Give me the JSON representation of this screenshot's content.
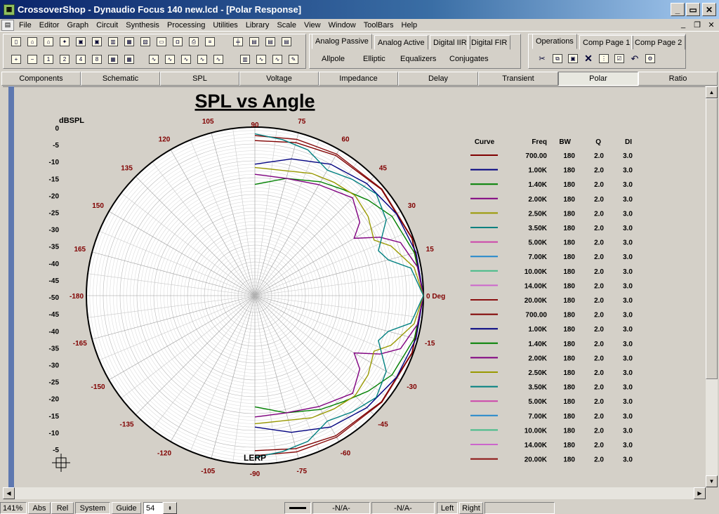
{
  "window": {
    "title": "CrossoverShop - Dynaudio Focus 140 new.lcd - [Polar Response]",
    "minimize": "_",
    "maximize": "▭",
    "close": "✕"
  },
  "menu": [
    "File",
    "Editor",
    "Graph",
    "Circuit",
    "Synthesis",
    "Processing",
    "Utilities",
    "Library",
    "Scale",
    "View",
    "Window",
    "ToolBars",
    "Help"
  ],
  "tabs_synthesis": [
    "Analog Passive",
    "Analog Active",
    "Digital IIR",
    "Digital FIR"
  ],
  "synthesis_subitems": [
    "Allpole",
    "Elliptic",
    "Equalizers",
    "Conjugates"
  ],
  "tabs_operations": [
    "Operations",
    "Comp Page 1",
    "Comp Page 2"
  ],
  "modes": [
    "Components",
    "Schematic",
    "SPL",
    "Voltage",
    "Impedance",
    "Delay",
    "Transient",
    "Polar",
    "Ratio"
  ],
  "active_mode": "Polar",
  "chart_data": {
    "type": "polar",
    "title": "SPL vs Angle",
    "radial_axis_label": "dBSPL",
    "radial_ticks": [
      "0",
      "-5",
      "-10",
      "-15",
      "-20",
      "-25",
      "-30",
      "-35",
      "-40",
      "-45",
      "-50",
      "-45",
      "-40",
      "-35",
      "-30",
      "-25",
      "-20",
      "-15",
      "-10",
      "-5"
    ],
    "angle_labels": [
      {
        "deg": 0,
        "text": "0 Deg"
      },
      {
        "deg": 15,
        "text": "15"
      },
      {
        "deg": 30,
        "text": "30"
      },
      {
        "deg": 45,
        "text": "45"
      },
      {
        "deg": 60,
        "text": "60"
      },
      {
        "deg": 75,
        "text": "75"
      },
      {
        "deg": 90,
        "text": "90"
      },
      {
        "deg": 105,
        "text": "105"
      },
      {
        "deg": 120,
        "text": "120"
      },
      {
        "deg": 135,
        "text": "135"
      },
      {
        "deg": 150,
        "text": "150"
      },
      {
        "deg": 165,
        "text": "165"
      },
      {
        "deg": 180,
        "text": "-180"
      },
      {
        "deg": -165,
        "text": "-165"
      },
      {
        "deg": -150,
        "text": "-150"
      },
      {
        "deg": -135,
        "text": "-135"
      },
      {
        "deg": -120,
        "text": "-120"
      },
      {
        "deg": -105,
        "text": "-105"
      },
      {
        "deg": -90,
        "text": "-90"
      },
      {
        "deg": -75,
        "text": "-75"
      },
      {
        "deg": -60,
        "text": "-60"
      },
      {
        "deg": -45,
        "text": "-45"
      },
      {
        "deg": -30,
        "text": "-30"
      },
      {
        "deg": -15,
        "text": "-15"
      }
    ],
    "annotation": "LERP",
    "table_headers": [
      "Curve",
      "Freq",
      "BW",
      "Q",
      "DI"
    ],
    "series": [
      {
        "freq": "700.00",
        "bw": "180",
        "q": "2.0",
        "di": "3.0",
        "color": "#800000",
        "side": "pos"
      },
      {
        "freq": "1.00K",
        "bw": "180",
        "q": "2.0",
        "di": "3.0",
        "color": "#000080",
        "side": "pos"
      },
      {
        "freq": "1.40K",
        "bw": "180",
        "q": "2.0",
        "di": "3.0",
        "color": "#008000",
        "side": "pos"
      },
      {
        "freq": "2.00K",
        "bw": "180",
        "q": "2.0",
        "di": "3.0",
        "color": "#800080",
        "side": "pos"
      },
      {
        "freq": "2.50K",
        "bw": "180",
        "q": "2.0",
        "di": "3.0",
        "color": "#999900",
        "side": "pos"
      },
      {
        "freq": "3.50K",
        "bw": "180",
        "q": "2.0",
        "di": "3.0",
        "color": "#008080",
        "side": "pos"
      },
      {
        "freq": "5.00K",
        "bw": "180",
        "q": "2.0",
        "di": "3.0",
        "color": "#cc44aa",
        "side": "pos"
      },
      {
        "freq": "7.00K",
        "bw": "180",
        "q": "2.0",
        "di": "3.0",
        "color": "#2288cc",
        "side": "pos"
      },
      {
        "freq": "10.00K",
        "bw": "180",
        "q": "2.0",
        "di": "3.0",
        "color": "#44bb88",
        "side": "pos"
      },
      {
        "freq": "14.00K",
        "bw": "180",
        "q": "2.0",
        "di": "3.0",
        "color": "#cc66cc",
        "side": "pos"
      },
      {
        "freq": "20.00K",
        "bw": "180",
        "q": "2.0",
        "di": "3.0",
        "color": "#8b1010",
        "side": "pos"
      },
      {
        "freq": "700.00",
        "bw": "180",
        "q": "2.0",
        "di": "3.0",
        "color": "#800000",
        "side": "neg"
      },
      {
        "freq": "1.00K",
        "bw": "180",
        "q": "2.0",
        "di": "3.0",
        "color": "#000080",
        "side": "neg"
      },
      {
        "freq": "1.40K",
        "bw": "180",
        "q": "2.0",
        "di": "3.0",
        "color": "#008000",
        "side": "neg"
      },
      {
        "freq": "2.00K",
        "bw": "180",
        "q": "2.0",
        "di": "3.0",
        "color": "#800080",
        "side": "neg"
      },
      {
        "freq": "2.50K",
        "bw": "180",
        "q": "2.0",
        "di": "3.0",
        "color": "#999900",
        "side": "neg"
      },
      {
        "freq": "3.50K",
        "bw": "180",
        "q": "2.0",
        "di": "3.0",
        "color": "#008080",
        "side": "neg"
      },
      {
        "freq": "5.00K",
        "bw": "180",
        "q": "2.0",
        "di": "3.0",
        "color": "#cc44aa",
        "side": "neg"
      },
      {
        "freq": "7.00K",
        "bw": "180",
        "q": "2.0",
        "di": "3.0",
        "color": "#2288cc",
        "side": "neg"
      },
      {
        "freq": "10.00K",
        "bw": "180",
        "q": "2.0",
        "di": "3.0",
        "color": "#44bb88",
        "side": "neg"
      },
      {
        "freq": "14.00K",
        "bw": "180",
        "q": "2.0",
        "di": "3.0",
        "color": "#cc66cc",
        "side": "neg"
      },
      {
        "freq": "20.00K",
        "bw": "180",
        "q": "2.0",
        "di": "3.0",
        "color": "#8b1010",
        "side": "neg"
      }
    ],
    "curves": [
      {
        "color": "#8b1010",
        "points": [
          [
            0,
            0
          ],
          [
            20,
            -0.3
          ],
          [
            40,
            -0.8
          ],
          [
            60,
            -1.5
          ],
          [
            75,
            -2
          ],
          [
            90,
            -2.5
          ]
        ]
      },
      {
        "color": "#800000",
        "points": [
          [
            0,
            0
          ],
          [
            20,
            -0.4
          ],
          [
            40,
            -1
          ],
          [
            60,
            -2
          ],
          [
            75,
            -3
          ],
          [
            90,
            -4
          ]
        ]
      },
      {
        "color": "#000080",
        "points": [
          [
            0,
            0
          ],
          [
            15,
            -0.5
          ],
          [
            30,
            -1.5
          ],
          [
            45,
            -3
          ],
          [
            60,
            -5
          ],
          [
            75,
            -8
          ],
          [
            90,
            -11
          ]
        ]
      },
      {
        "color": "#008000",
        "points": [
          [
            0,
            0
          ],
          [
            15,
            -1
          ],
          [
            30,
            -3
          ],
          [
            40,
            -6
          ],
          [
            50,
            -9
          ],
          [
            60,
            -11
          ],
          [
            75,
            -14
          ],
          [
            90,
            -17
          ]
        ]
      },
      {
        "color": "#800080",
        "points": [
          [
            0,
            0
          ],
          [
            10,
            -1
          ],
          [
            20,
            -4
          ],
          [
            25,
            -9
          ],
          [
            30,
            -16
          ],
          [
            35,
            -12
          ],
          [
            45,
            -9
          ],
          [
            60,
            -12
          ],
          [
            75,
            -14
          ],
          [
            90,
            -14
          ]
        ]
      },
      {
        "color": "#999900",
        "points": [
          [
            0,
            0
          ],
          [
            10,
            -2
          ],
          [
            20,
            -7
          ],
          [
            25,
            -11
          ],
          [
            35,
            -9
          ],
          [
            45,
            -8
          ],
          [
            55,
            -9
          ],
          [
            65,
            -10
          ],
          [
            90,
            -12
          ]
        ]
      },
      {
        "color": "#008080",
        "points": [
          [
            0,
            0
          ],
          [
            10,
            -3
          ],
          [
            15,
            -9
          ],
          [
            20,
            -11
          ],
          [
            30,
            -5
          ],
          [
            40,
            -3
          ],
          [
            50,
            -5
          ],
          [
            60,
            -7
          ],
          [
            70,
            -4
          ],
          [
            80,
            -3
          ],
          [
            90,
            -2
          ]
        ]
      }
    ]
  },
  "status": {
    "zoom": "141%",
    "btn_abs": "Abs",
    "btn_rel": "Rel",
    "btn_system": "System",
    "btn_guide": "Guide",
    "guide_value": "54",
    "na1": "-N/A-",
    "na2": "-N/A-",
    "btn_left": "Left",
    "btn_right": "Right"
  }
}
